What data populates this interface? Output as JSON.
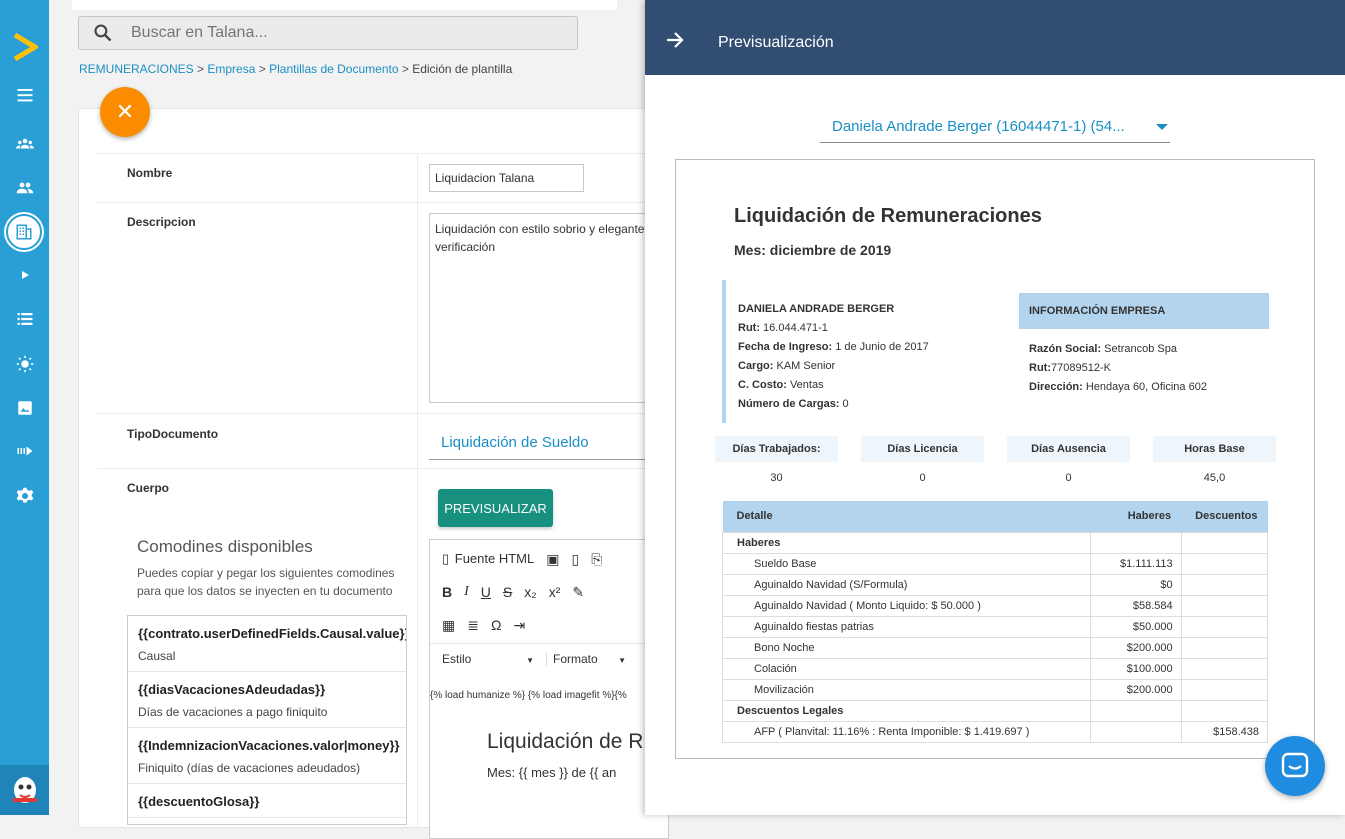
{
  "search": {
    "placeholder": "Buscar en Talana..."
  },
  "breadcrumb": {
    "items": [
      "REMUNERACIONES",
      "Empresa",
      "Plantillas de Documento"
    ],
    "current": "Edición de plantilla",
    "sep": " > "
  },
  "form": {
    "nombre_label": "Nombre",
    "nombre_value": "Liquidacion Talana",
    "descripcion_label": "Descripcion",
    "descripcion_value": "Liquidación con estilo sobrio y elegante verificación",
    "tipo_label": "TipoDocumento",
    "tipo_value": "Liquidación de Sueldo",
    "cuerpo_label": "Cuerpo",
    "preview_button": "PREVISUALIZAR"
  },
  "comodines": {
    "title": "Comodines disponibles",
    "description": "Puedes copiar y pegar los siguientes comodines para que los datos se inyecten en tu documento",
    "items": [
      {
        "key": "{{contrato.userDefinedFields.Causal.value}}",
        "desc": "Causal"
      },
      {
        "key": "{{diasVacacionesAdeudadas}}",
        "desc": "Días de vacaciones a pago finiquito"
      },
      {
        "key": "{{IndemnizacionVacaciones.valor|money}}",
        "desc": "Finiquito (días de vacaciones adeudados)"
      },
      {
        "key": "{{descuentoGlosa}}",
        "desc": ""
      }
    ]
  },
  "editor": {
    "source_label": "Fuente HTML",
    "style_label": "Estilo",
    "format_label": "Formato",
    "code_line": "{% load humanize %} {% load imagefit %}{%",
    "heading": "Liquidación de R",
    "mes_line": "Mes: {{ mes }} de {{ an"
  },
  "panel": {
    "title": "Previsualización",
    "employee_select": "Daniela Andrade Berger (16044471-1) (54..."
  },
  "document": {
    "title": "Liquidación de Remuneraciones",
    "month": "Mes: diciembre de 2019",
    "employee": {
      "name": "DANIELA ANDRADE BERGER",
      "fields": [
        {
          "label": "Rut:",
          "value": " 16.044.471-1"
        },
        {
          "label": "Fecha de Ingreso:",
          "value": " 1 de Junio de 2017"
        },
        {
          "label": "Cargo:",
          "value": " KAM Senior"
        },
        {
          "label": "C. Costo:",
          "value": " Ventas"
        },
        {
          "label": "Número de Cargas:",
          "value": " 0"
        }
      ]
    },
    "company": {
      "header": "INFORMACIÓN EMPRESA",
      "fields": [
        {
          "label": "Razón Social:",
          "value": " Setrancob Spa"
        },
        {
          "label": "Rut:",
          "value": "77089512-K"
        },
        {
          "label": "Dirección:",
          "value": " Hendaya 60, Oficina 602"
        }
      ]
    },
    "stats": [
      {
        "label": "Días Trabajados:",
        "value": "30"
      },
      {
        "label": "Días Licencia",
        "value": "0"
      },
      {
        "label": "Días Ausencia",
        "value": "0"
      },
      {
        "label": "Horas Base",
        "value": "45,0"
      }
    ],
    "table": {
      "headers": [
        "Detalle",
        "Haberes",
        "Descuentos"
      ],
      "sections": [
        {
          "title": "Haberes",
          "rows": [
            {
              "item": "Sueldo Base",
              "haber": "$1.111.113",
              "desc": ""
            },
            {
              "item": "Aguinaldo Navidad (S/Formula)",
              "haber": "$0",
              "desc": ""
            },
            {
              "item": "Aguinaldo Navidad ( Monto Liquido: $ 50.000 )",
              "haber": "$58.584",
              "desc": ""
            },
            {
              "item": "Aguinaldo fiestas patrias",
              "haber": "$50.000",
              "desc": ""
            },
            {
              "item": "Bono Noche",
              "haber": "$200.000",
              "desc": ""
            },
            {
              "item": "Colación",
              "haber": "$100.000",
              "desc": ""
            },
            {
              "item": "Movilización",
              "haber": "$200.000",
              "desc": ""
            }
          ]
        },
        {
          "title": "Descuentos Legales",
          "rows": [
            {
              "item": "AFP ( Planvital: 11.16% : Renta Imponible: $ 1.419.697 )",
              "haber": "",
              "desc": "$158.438"
            }
          ]
        }
      ]
    }
  }
}
